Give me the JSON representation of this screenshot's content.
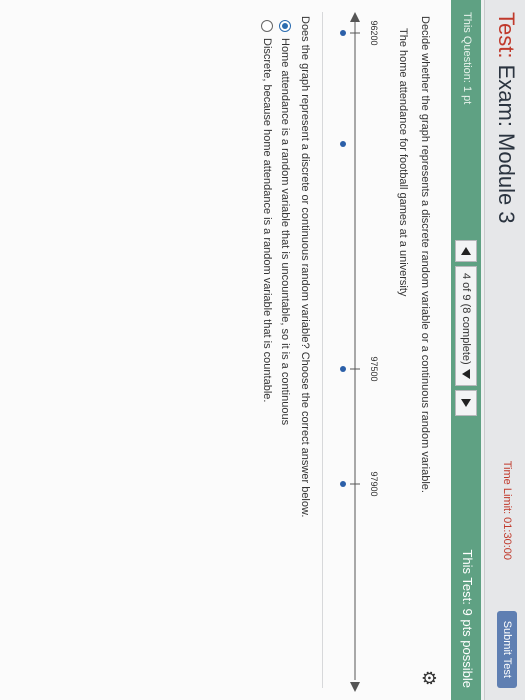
{
  "header": {
    "title_prefix": "Test:",
    "title_rest": " Exam: Module 3",
    "time_limit": "Time Limit: 01:30:00",
    "submit_label": "Submit Test"
  },
  "question_bar": {
    "this_question": "This Question: 1 pt",
    "progress": "4 of 9 (8 complete)",
    "this_test": "This Test: 9 pts possible"
  },
  "question": {
    "prompt": "Decide whether the graph represents a discrete random variable or a continuous random variable.",
    "graph_title": "The home attendance for football games at a university",
    "number_line": {
      "labels": [
        "96200",
        "97500",
        "97900"
      ]
    },
    "ask": "Does the graph represent a discrete or continuous random variable? Choose the correct answer below.",
    "options": [
      {
        "label": "Home attendance is a random variable that is uncountable, so it is a continuous",
        "selected": true
      },
      {
        "label": "Discrete, because home attendance is a random variable that is countable.",
        "selected": false
      }
    ]
  },
  "colors": {
    "accent_green": "#5fa183",
    "title_red": "#c0392b",
    "submit_blue": "#5f7fb2",
    "dot_blue": "#2b5fa8"
  }
}
